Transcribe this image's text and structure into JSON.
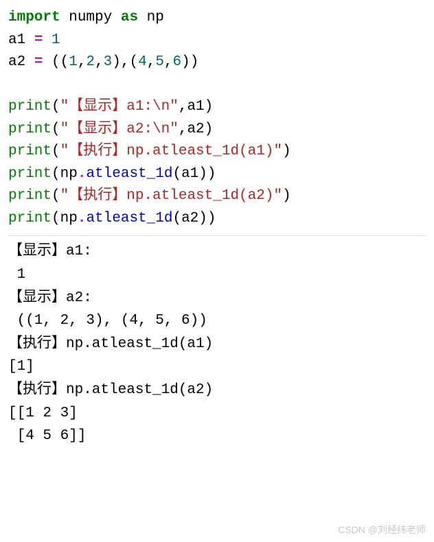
{
  "code": {
    "line1": {
      "kw1": "import",
      "name1": " numpy ",
      "kw2": "as",
      "name2": " np"
    },
    "line2": {
      "name": "a1 ",
      "op": "=",
      "rest": " ",
      "num": "1"
    },
    "line3": {
      "name": "a2 ",
      "op": "=",
      "sp": " ((",
      "n1": "1",
      "c1": ",",
      "n2": "2",
      "c2": ",",
      "n3": "3",
      "c3": "),(",
      "n4": "4",
      "c4": ",",
      "n5": "5",
      "c5": ",",
      "n6": "6",
      "c6": "))"
    },
    "line4": "",
    "line5": {
      "call": "print",
      "p1": "(",
      "str": "\"【显示】a1:\\n\"",
      "c": ",a1)"
    },
    "line6": {
      "call": "print",
      "p1": "(",
      "str": "\"【显示】a2:\\n\"",
      "c": ",a2)"
    },
    "line7": {
      "call": "print",
      "p1": "(",
      "str": "\"【执行】np.atleast_1d(a1)\"",
      "c": ")"
    },
    "line8": {
      "call": "print",
      "p1": "(np",
      "dot": ".",
      "attr": "atleast_1d",
      "rest": "(a1))"
    },
    "line9": {
      "call": "print",
      "p1": "(",
      "str": "\"【执行】np.atleast_1d(a2)\"",
      "c": ")"
    },
    "line10": {
      "call": "print",
      "p1": "(np",
      "dot": ".",
      "attr": "atleast_1d",
      "rest": "(a2))"
    }
  },
  "output": {
    "l1": "【显示】a1:",
    "l2": " 1",
    "l3": "【显示】a2:",
    "l4": " ((1, 2, 3), (4, 5, 6))",
    "l5": "【执行】np.atleast_1d(a1)",
    "l6": "[1]",
    "l7": "【执行】np.atleast_1d(a2)",
    "l8": "[[1 2 3]",
    "l9": " [4 5 6]]"
  },
  "watermark": "CSDN @刘经纬老师"
}
